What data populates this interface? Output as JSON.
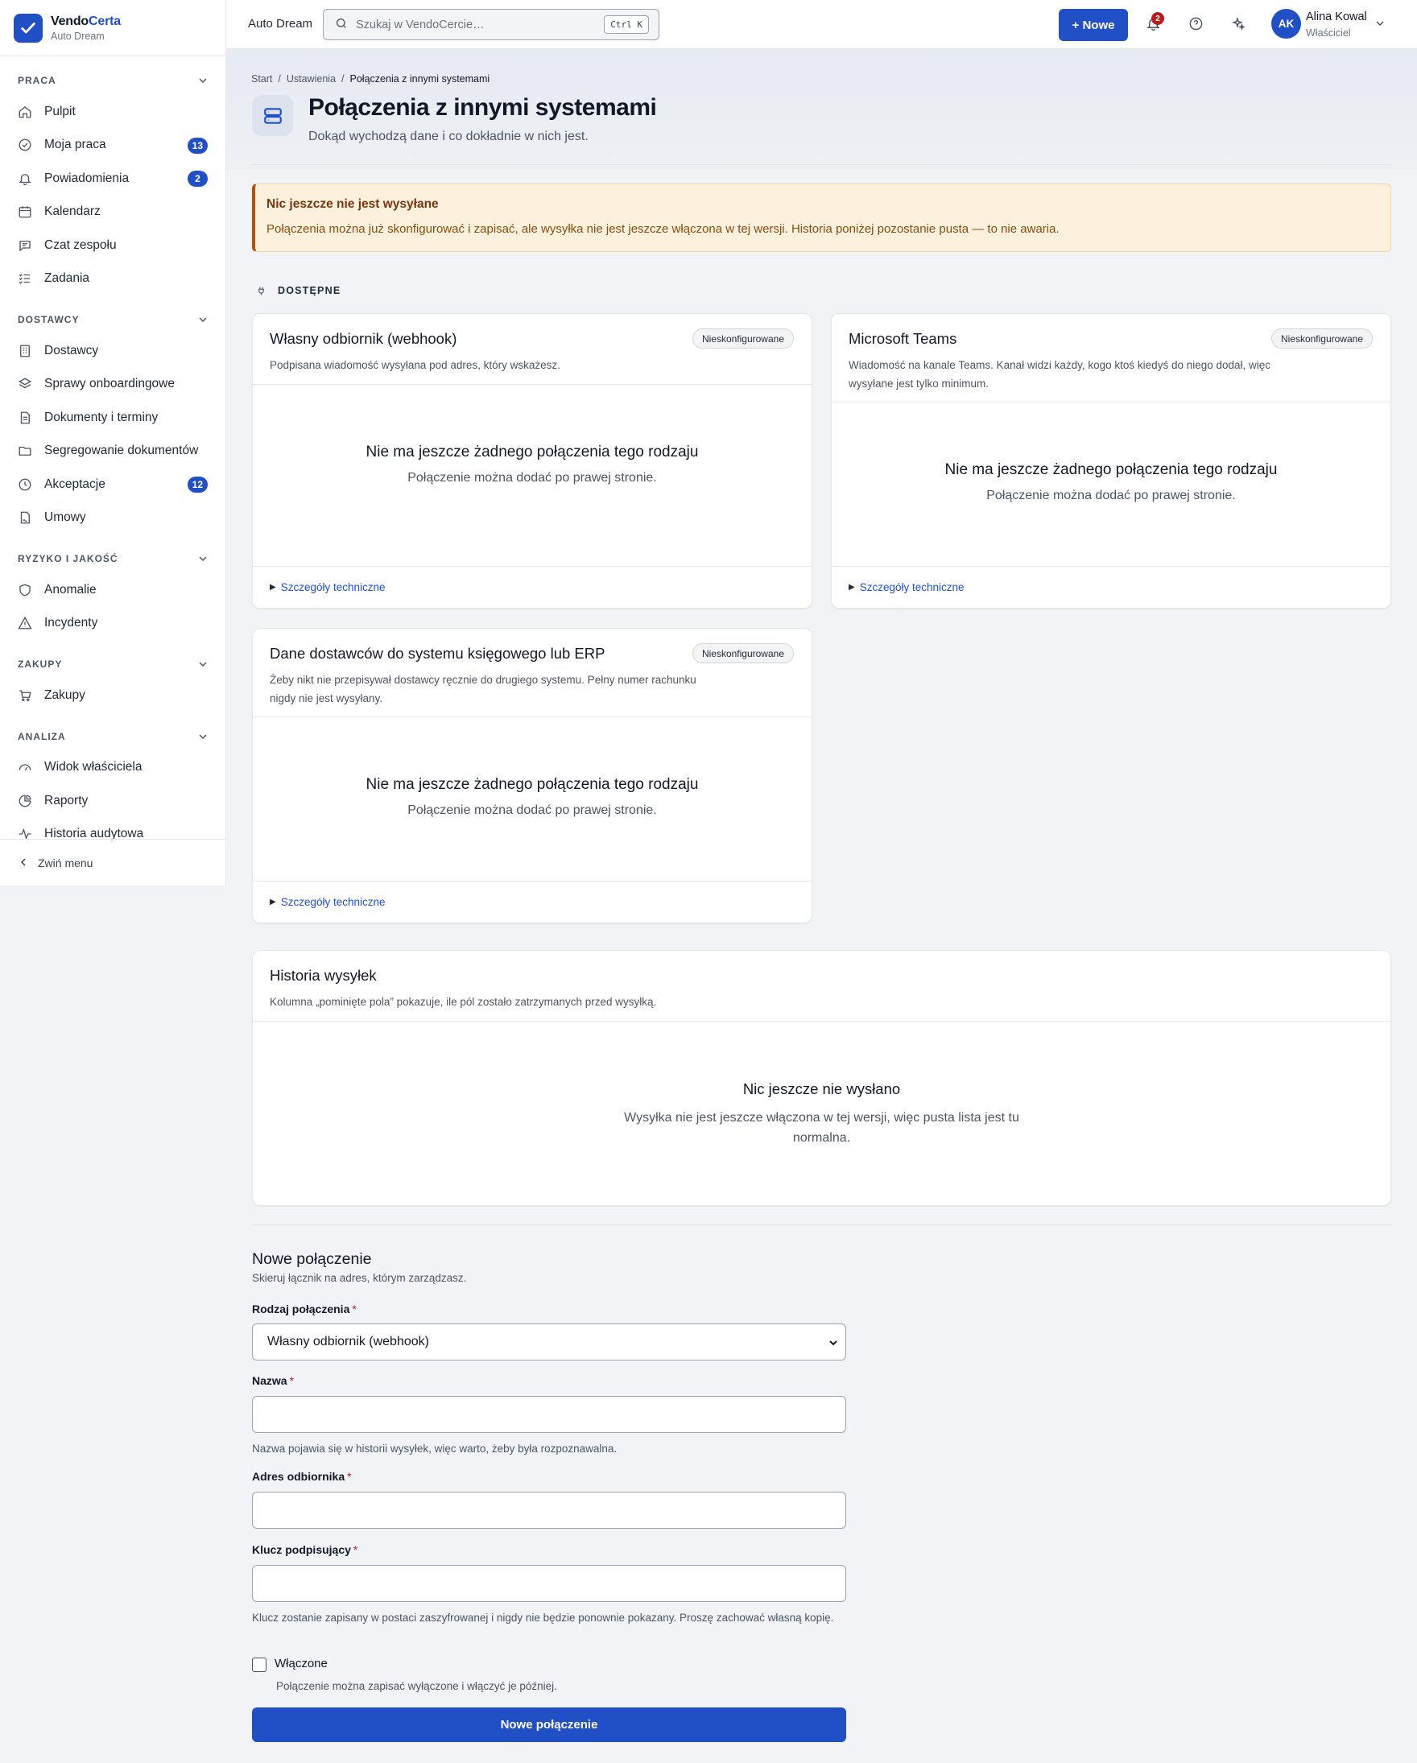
{
  "brand": {
    "name_part1": "Vendo",
    "name_part2": "Certa",
    "org": "Auto Dream"
  },
  "sidebar": {
    "groups": [
      {
        "title": "PRACA",
        "items": [
          {
            "label": "Pulpit",
            "icon": "home-icon"
          },
          {
            "label": "Moja praca",
            "icon": "check-circle-icon",
            "badge": "13"
          },
          {
            "label": "Powiadomienia",
            "icon": "bell-icon",
            "badge": "2"
          },
          {
            "label": "Kalendarz",
            "icon": "calendar-icon"
          },
          {
            "label": "Czat zespołu",
            "icon": "chat-icon"
          },
          {
            "label": "Zadania",
            "icon": "list-check-icon"
          }
        ]
      },
      {
        "title": "DOSTAWCY",
        "items": [
          {
            "label": "Dostawcy",
            "icon": "building-icon"
          },
          {
            "label": "Sprawy onboardingowe",
            "icon": "layers-icon"
          },
          {
            "label": "Dokumenty i terminy",
            "icon": "document-icon"
          },
          {
            "label": "Segregowanie dokumentów",
            "icon": "folder-icon"
          },
          {
            "label": "Akceptacje",
            "icon": "clock-icon",
            "badge": "12"
          },
          {
            "label": "Umowy",
            "icon": "contract-icon"
          }
        ]
      },
      {
        "title": "RYZYKO I JAKOŚĆ",
        "items": [
          {
            "label": "Anomalie",
            "icon": "shield-icon"
          },
          {
            "label": "Incydenty",
            "icon": "warning-icon"
          }
        ]
      },
      {
        "title": "ZAKUPY",
        "items": [
          {
            "label": "Zakupy",
            "icon": "cart-icon"
          }
        ]
      },
      {
        "title": "ANALIZA",
        "items": [
          {
            "label": "Widok właściciela",
            "icon": "gauge-icon"
          },
          {
            "label": "Raporty",
            "icon": "pie-chart-icon"
          },
          {
            "label": "Historia audytowa",
            "icon": "activity-icon"
          }
        ]
      }
    ],
    "collapse_label": "Zwiń menu"
  },
  "topbar": {
    "org": "Auto Dream",
    "search_placeholder": "Szukaj w VendoCercie…",
    "search_shortcut": "Ctrl K",
    "new_label": "+ Nowe",
    "notif_count": "2",
    "user_initials": "AK",
    "user_name": "Alina Kowal",
    "user_role": "Właściciel"
  },
  "breadcrumb": [
    "Start",
    "Ustawienia",
    "Połączenia z innymi systemami"
  ],
  "page": {
    "title": "Połączenia z innymi systemami",
    "subtitle": "Dokąd wychodzą dane i co dokładnie w nich jest."
  },
  "alert": {
    "title": "Nic jeszcze nie jest wysyłane",
    "body": "Połączenia można już skonfigurować i zapisać, ale wysyłka nie jest jeszcze włączona w tej wersji. Historia poniżej pozostanie pusta — to nie awaria."
  },
  "available_label": "DOSTĘPNE",
  "connectors": [
    {
      "title": "Własny odbiornik (webhook)",
      "status": "Nieskonfigurowane",
      "desc": "Podpisana wiadomość wysyłana pod adres, który wskażesz.",
      "empty_title": "Nie ma jeszcze żadnego połączenia tego rodzaju",
      "empty_text": "Połączenie można dodać po prawej stronie.",
      "details": "Szczegóły techniczne"
    },
    {
      "title": "Microsoft Teams",
      "status": "Nieskonfigurowane",
      "desc": "Wiadomość na kanale Teams. Kanał widzi każdy, kogo ktoś kiedyś do niego dodał, więc wysyłane jest tylko minimum.",
      "empty_title": "Nie ma jeszcze żadnego połączenia tego rodzaju",
      "empty_text": "Połączenie można dodać po prawej stronie.",
      "details": "Szczegóły techniczne"
    },
    {
      "title": "Dane dostawców do systemu księgowego lub ERP",
      "status": "Nieskonfigurowane",
      "desc": "Żeby nikt nie przepisywał dostawcy ręcznie do drugiego systemu. Pełny numer rachunku nigdy nie jest wysyłany.",
      "empty_title": "Nie ma jeszcze żadnego połączenia tego rodzaju",
      "empty_text": "Połączenie można dodać po prawej stronie.",
      "details": "Szczegóły techniczne"
    }
  ],
  "history": {
    "title": "Historia wysyłek",
    "desc": "Kolumna „pominięte pola” pokazuje, ile pól zostało zatrzymanych przed wysyłką.",
    "empty_title": "Nic jeszcze nie wysłano",
    "empty_text": "Wysyłka nie jest jeszcze włączona w tej wersji, więc pusta lista jest tu normalna."
  },
  "form": {
    "title": "Nowe połączenie",
    "subtitle": "Skieruj łącznik na adres, którym zarządzasz.",
    "type_label": "Rodzaj połączenia",
    "type_value": "Własny odbiornik (webhook)",
    "name_label": "Nazwa",
    "name_value": "",
    "name_hint": "Nazwa pojawia się w historii wysyłek, więc warto, żeby była rozpoznawalna.",
    "url_label": "Adres odbiornika",
    "url_value": "",
    "key_label": "Klucz podpisujący",
    "key_value": "",
    "key_hint": "Klucz zostanie zapisany w postaci zaszyfrowanej i nigdy nie będzie ponownie pokazany. Proszę zachować własną kopię.",
    "enabled_label": "Włączone",
    "enabled_checked": false,
    "enabled_hint": "Połączenie można zapisać wyłączone i włączyć je później.",
    "required_mark": "*",
    "submit_label": "Nowe połączenie"
  }
}
